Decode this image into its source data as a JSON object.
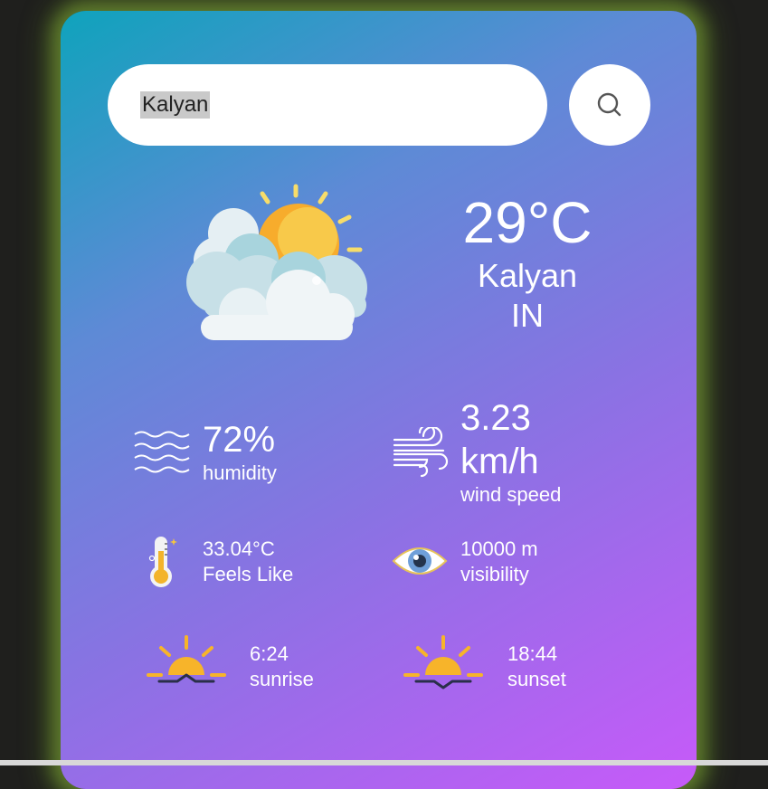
{
  "search": {
    "value": "Kalyan",
    "icon": "search-icon"
  },
  "weather": {
    "icon": "partly-cloudy-icon",
    "temperature": "29°C",
    "city": "Kalyan",
    "country": "IN"
  },
  "details": {
    "humidity": {
      "value": "72%",
      "label": "humidity",
      "icon": "waves-icon"
    },
    "wind": {
      "value_line1": "3.23",
      "value_line2": "km/h",
      "label": "wind speed",
      "icon": "wind-icon"
    },
    "feels_like": {
      "value": "33.04°C",
      "label": "Feels Like",
      "icon": "thermometer-icon"
    },
    "visibility": {
      "value": "10000 m",
      "label": "visibility",
      "icon": "eye-icon"
    },
    "sunrise": {
      "value": "6:24",
      "label": "sunrise",
      "icon": "sunrise-icon"
    },
    "sunset": {
      "value": "18:44",
      "label": "sunset",
      "icon": "sunset-icon"
    }
  },
  "colors": {
    "gradient_start": "#0fa3bc",
    "gradient_end": "#c75af9",
    "glow": "#5e7a2c"
  }
}
